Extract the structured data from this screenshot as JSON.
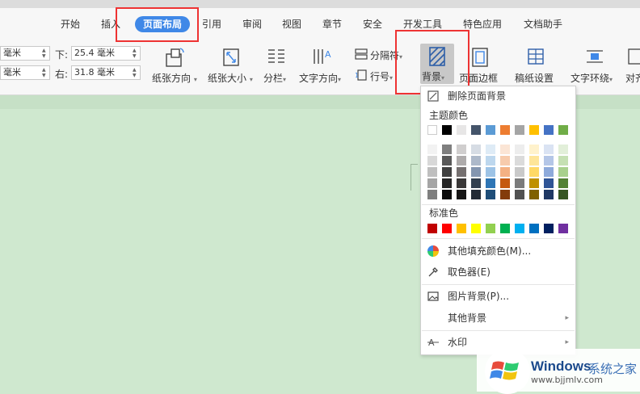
{
  "tabs": [
    {
      "label": "开始",
      "active": false
    },
    {
      "label": "插入",
      "active": false
    },
    {
      "label": "页面布局",
      "active": true
    },
    {
      "label": "引用",
      "active": false
    },
    {
      "label": "审阅",
      "active": false
    },
    {
      "label": "视图",
      "active": false
    },
    {
      "label": "章节",
      "active": false
    },
    {
      "label": "安全",
      "active": false
    },
    {
      "label": "开发工具",
      "active": false
    },
    {
      "label": "特色应用",
      "active": false
    },
    {
      "label": "文档助手",
      "active": false
    }
  ],
  "margins": {
    "unit_cut1": "毫米",
    "unit_cut2": "毫米",
    "bottom_label": "下:",
    "bottom_value": "25.4 毫米",
    "right_label": "右:",
    "right_value": "31.8 毫米"
  },
  "toolbar": {
    "orientation": "纸张方向",
    "size": "纸张大小",
    "columns": "分栏",
    "text_direction": "文字方向",
    "separator": "分隔符",
    "line_number": "行号",
    "background": "背景",
    "page_border": "页面边框",
    "manuscript": "稿纸设置",
    "wrap": "文字环绕",
    "align": "对齐"
  },
  "dropdown": {
    "delete_bg": "删除页面背景",
    "theme_colors_title": "主题颜色",
    "standard_colors_title": "标准色",
    "more_fill": "其他填充颜色(M)...",
    "picker": "取色器(E)",
    "picture_bg": "图片背景(P)...",
    "other_bg": "其他背景",
    "watermark": "水印"
  },
  "colors": {
    "accent": "#3f88e7",
    "highlight": "#e33333",
    "page_bg": "#cfe8cf",
    "theme_row": [
      "#ffffff",
      "#000000",
      "#e7e6e6",
      "#44546a",
      "#5b9bd5",
      "#ed7d31",
      "#a5a5a5",
      "#ffc000",
      "#4472c4",
      "#70ad47"
    ],
    "shade_rows": [
      [
        "#f2f2f2",
        "#7f7f7f",
        "#d0cece",
        "#d6dce4",
        "#deebf6",
        "#fbe5d5",
        "#ededed",
        "#fff2cc",
        "#dae3f3",
        "#e2efd9"
      ],
      [
        "#d8d8d8",
        "#595959",
        "#aeabab",
        "#adb9ca",
        "#bdd7ee",
        "#f7cbac",
        "#dbdbdb",
        "#fee599",
        "#b4c6e7",
        "#c5e0b3"
      ],
      [
        "#bfbfbf",
        "#3f3f3f",
        "#757070",
        "#8496b0",
        "#9dc3e6",
        "#f4b183",
        "#c9c9c9",
        "#ffd966",
        "#8eaadb",
        "#a8d08d"
      ],
      [
        "#a5a5a5",
        "#262626",
        "#3a3838",
        "#323f4f",
        "#2e75b5",
        "#c55a11",
        "#7b7b7b",
        "#bf9000",
        "#2f5496",
        "#538135"
      ],
      [
        "#7f7f7f",
        "#0c0c0c",
        "#171616",
        "#222a35",
        "#1f4e79",
        "#833c0b",
        "#525252",
        "#7f6000",
        "#1f3864",
        "#375623"
      ]
    ],
    "standard_row": [
      "#c00000",
      "#ff0000",
      "#ffc000",
      "#ffff00",
      "#92d050",
      "#00b050",
      "#00b0f0",
      "#0070c0",
      "#002060",
      "#7030a0"
    ]
  },
  "watermark_brand": {
    "name": "Windows",
    "cn": "系统之家",
    "url": "www.bjjmlv.com"
  }
}
